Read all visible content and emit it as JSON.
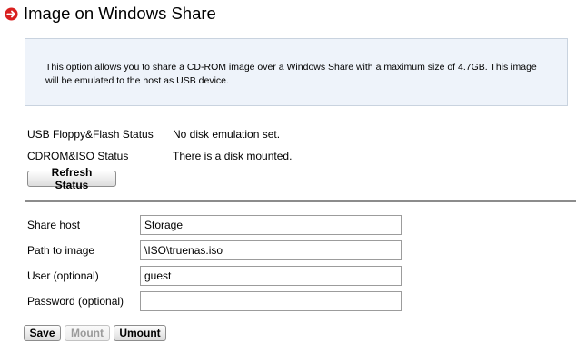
{
  "header": {
    "title": "Image on Windows Share",
    "icon": "arrow-right-circle-icon",
    "icon_color": "#d9201f"
  },
  "info": {
    "text": "This option allows you to share a CD-ROM image over a Windows Share with a maximum size of 4.7GB. This image will be emulated to the host as USB device."
  },
  "status": [
    {
      "label": "USB Floppy&Flash Status",
      "value": "No disk emulation set."
    },
    {
      "label": "CDROM&ISO Status",
      "value": "There is a disk mounted."
    }
  ],
  "buttons": {
    "refresh": "Refresh Status",
    "save": "Save",
    "mount": "Mount",
    "umount": "Umount"
  },
  "form": {
    "share_host": {
      "label": "Share host",
      "value": "Storage"
    },
    "path": {
      "label": "Path to image",
      "value": "\\ISO\\truenas.iso"
    },
    "user": {
      "label": "User (optional)",
      "value": "guest"
    },
    "password": {
      "label": "Password (optional)",
      "value": ""
    }
  }
}
